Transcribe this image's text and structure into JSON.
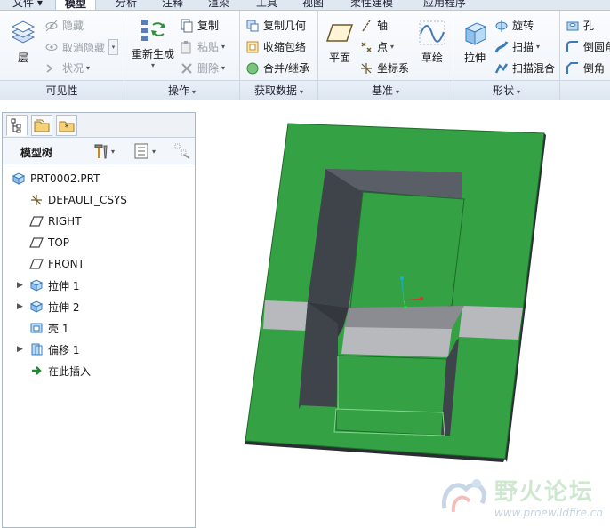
{
  "tabs": [
    {
      "label": "文件 ▾",
      "active": false
    },
    {
      "label": "模型",
      "active": true
    },
    {
      "label": "分析",
      "active": false
    },
    {
      "label": "注释",
      "active": false
    },
    {
      "label": "渲染",
      "active": false
    },
    {
      "label": "工具",
      "active": false
    },
    {
      "label": "视图",
      "active": false
    },
    {
      "label": "柔性建模",
      "active": false
    },
    {
      "label": "应用程序",
      "active": false
    }
  ],
  "ribbon": {
    "visibility": {
      "label": "可见性",
      "layer": "层",
      "hide": "隐藏",
      "unhide": "取消隐藏",
      "status": "状况"
    },
    "operations": {
      "label": "操作",
      "regenerate": "重新生成",
      "copy": "复制",
      "paste": "粘贴",
      "delete": "删除"
    },
    "get_data": {
      "label": "获取数据",
      "copy_geom": "复制几何",
      "shrinkwrap": "收缩包络",
      "merge_inherit": "合并/继承"
    },
    "datum": {
      "label": "基准",
      "plane": "平面",
      "axis": "轴",
      "point": "点",
      "csys": "坐标系",
      "sketch": "草绘"
    },
    "shapes": {
      "label": "形状",
      "extrude": "拉伸",
      "revolve": "旋转",
      "sweep": "扫描",
      "swept_blend": "扫描混合"
    },
    "engineering": {
      "hole": "孔",
      "round": "倒圆角",
      "chamfer": "倒角"
    }
  },
  "model_tree": {
    "title": "模型树",
    "items": [
      {
        "label": "PRT0002.PRT",
        "icon": "part-icon",
        "expandable": false
      },
      {
        "label": "DEFAULT_CSYS",
        "icon": "csys-icon",
        "expandable": false
      },
      {
        "label": "RIGHT",
        "icon": "datum-plane-icon",
        "expandable": false
      },
      {
        "label": "TOP",
        "icon": "datum-plane-icon",
        "expandable": false
      },
      {
        "label": "FRONT",
        "icon": "datum-plane-icon",
        "expandable": false
      },
      {
        "label": "拉伸 1",
        "icon": "extrude-icon",
        "expandable": true
      },
      {
        "label": "拉伸 2",
        "icon": "extrude-icon",
        "expandable": true
      },
      {
        "label": "壳 1",
        "icon": "shell-icon",
        "expandable": false
      },
      {
        "label": "偏移 1",
        "icon": "offset-icon",
        "expandable": true
      },
      {
        "label": "在此插入",
        "icon": "insert-here-icon",
        "expandable": false
      }
    ]
  },
  "watermark": {
    "title": "野火论坛",
    "url": "www.proewildfire.cn"
  },
  "colors": {
    "model_green": "#34a144",
    "model_dark": "#3f434a",
    "accent": "#2a6cc9"
  }
}
